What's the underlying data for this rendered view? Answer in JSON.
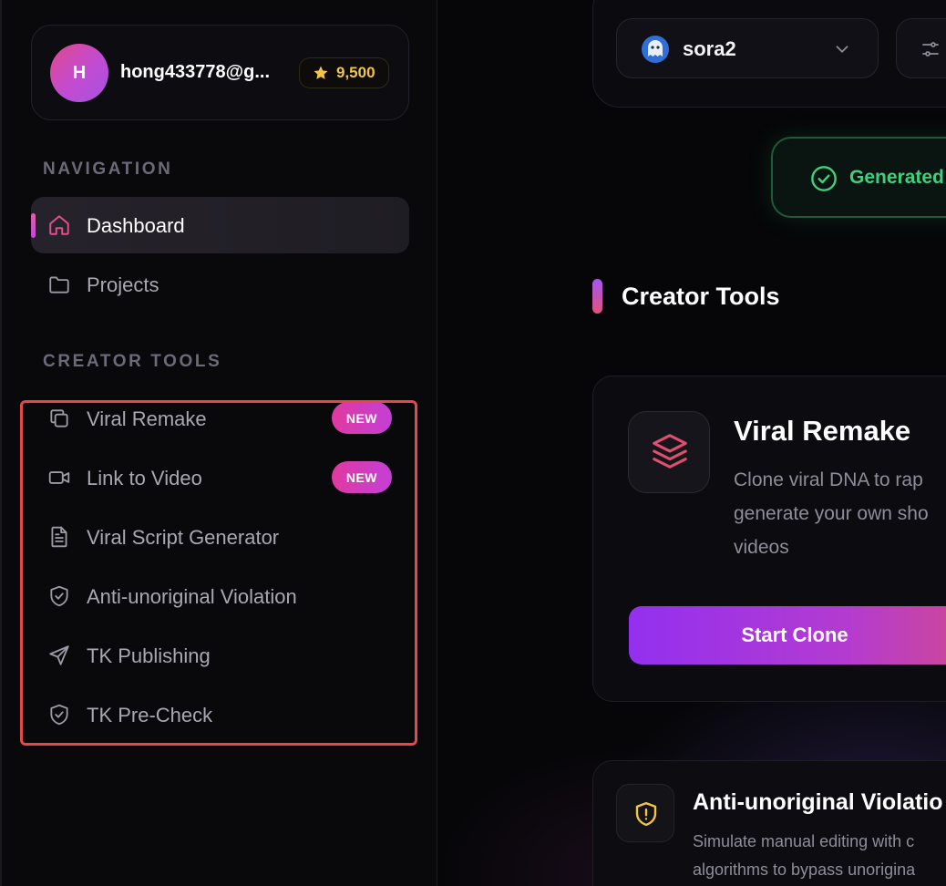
{
  "user": {
    "avatar_initial": "H",
    "email": "hong433778@g...",
    "credits": "9,500"
  },
  "sidebar": {
    "navigation_title": "NAVIGATION",
    "navigation": [
      {
        "label": "Dashboard",
        "icon": "home-icon",
        "active": true
      },
      {
        "label": "Projects",
        "icon": "folder-icon",
        "active": false
      }
    ],
    "creator_tools_title": "CREATOR TOOLS",
    "creator_tools": [
      {
        "label": "Viral Remake",
        "icon": "copy-icon",
        "badge": "NEW"
      },
      {
        "label": "Link to Video",
        "icon": "video-camera-icon",
        "badge": "NEW"
      },
      {
        "label": "Viral Script Generator",
        "icon": "document-icon"
      },
      {
        "label": "Anti-unoriginal Violation",
        "icon": "shield-check-icon"
      },
      {
        "label": "TK Publishing",
        "icon": "send-icon"
      },
      {
        "label": "TK Pre-Check",
        "icon": "shield-check-icon"
      }
    ]
  },
  "top_bar": {
    "model": "sora2",
    "status": "Generated"
  },
  "main": {
    "section_title": "Creator Tools",
    "cards": [
      {
        "title": "Viral Remake",
        "description_lines": [
          "Clone viral DNA to rap",
          "generate your own sho",
          "videos"
        ],
        "button": "Start Clone"
      },
      {
        "title": "Anti-unoriginal Violatio",
        "description_lines": [
          "Simulate manual editing with c",
          "algorithms to bypass unorigina"
        ]
      }
    ]
  },
  "colors": {
    "accent_pink": "#e03aa0",
    "accent_purple": "#9330ef",
    "credits_gold": "#f4c542",
    "status_green": "#3fcf7e",
    "highlight_red": "#e24a4a"
  }
}
